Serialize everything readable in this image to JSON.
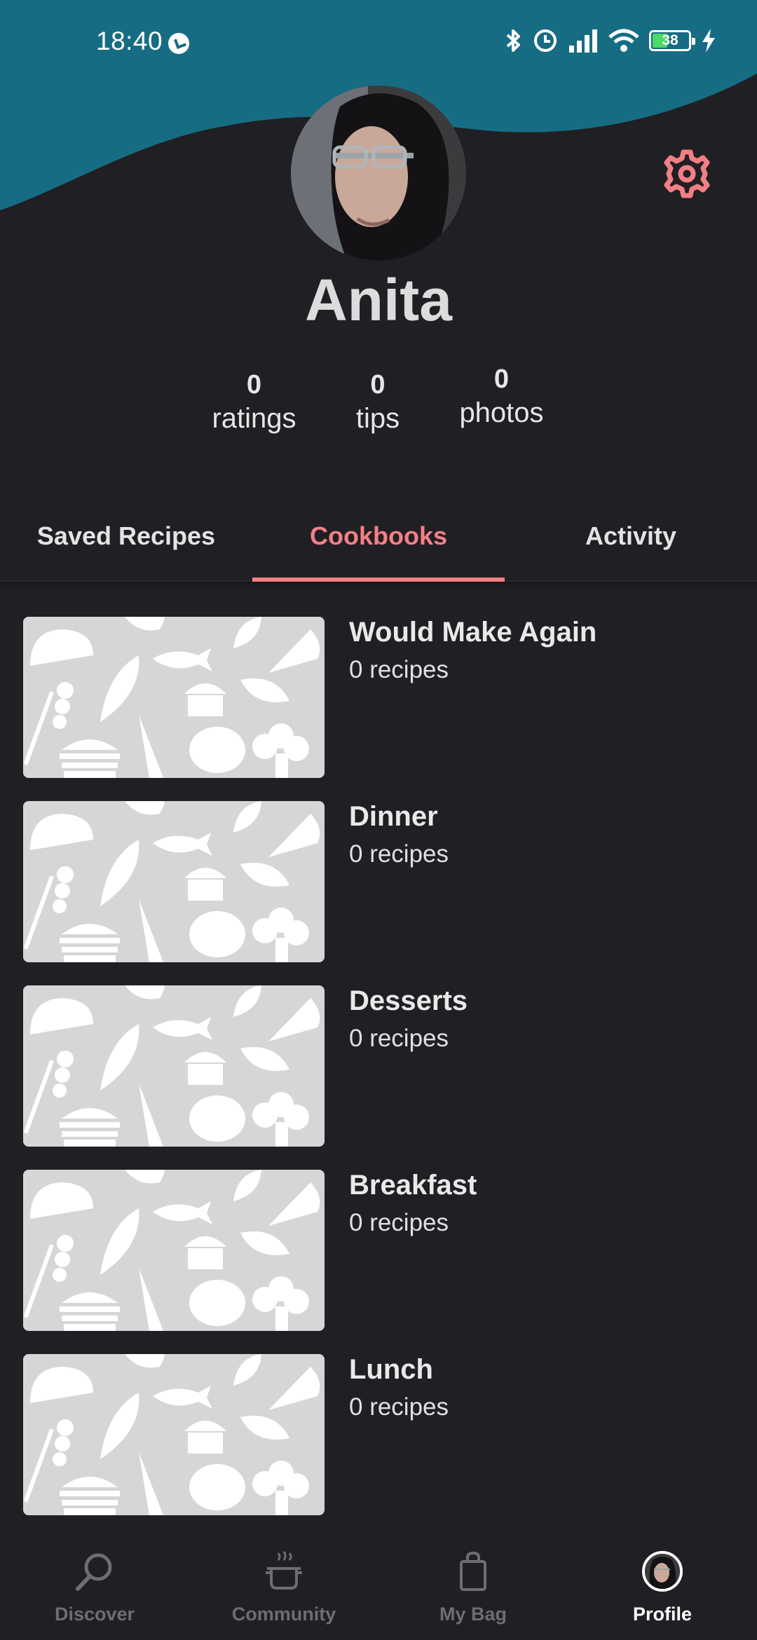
{
  "status_bar": {
    "time": "18:40",
    "battery_level": "38",
    "icons": [
      "bluetooth-icon",
      "alarm-icon",
      "signal-icon",
      "wifi-icon",
      "battery-icon",
      "charging-icon"
    ]
  },
  "colors": {
    "header": "#166d83",
    "background": "#201f23",
    "accent": "#f27f86",
    "thumbnail": "#d6d6d6"
  },
  "profile": {
    "name": "Anita",
    "stats": [
      {
        "value": "0",
        "label": "ratings"
      },
      {
        "value": "0",
        "label": "tips"
      },
      {
        "value": "0",
        "label": "photos"
      }
    ]
  },
  "tabs": [
    {
      "label": "Saved Recipes",
      "active": false
    },
    {
      "label": "Cookbooks",
      "active": true
    },
    {
      "label": "Activity",
      "active": false
    }
  ],
  "cookbooks": [
    {
      "title": "Would Make Again",
      "count": "0 recipes"
    },
    {
      "title": "Dinner",
      "count": "0 recipes"
    },
    {
      "title": "Desserts",
      "count": "0 recipes"
    },
    {
      "title": "Breakfast",
      "count": "0 recipes"
    },
    {
      "title": "Lunch",
      "count": "0 recipes"
    }
  ],
  "bottom_nav": [
    {
      "label": "Discover",
      "icon": "search-icon",
      "active": false
    },
    {
      "label": "Community",
      "icon": "pot-icon",
      "active": false
    },
    {
      "label": "My Bag",
      "icon": "bag-icon",
      "active": false
    },
    {
      "label": "Profile",
      "icon": "avatar-icon",
      "active": true
    }
  ]
}
